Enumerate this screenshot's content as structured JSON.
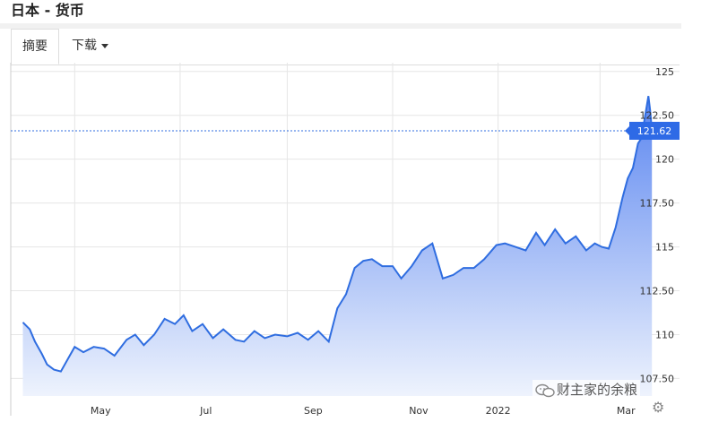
{
  "title": "日本 - 货币",
  "tabs": {
    "summary": "摘要",
    "download": "下载"
  },
  "watermark": "财主家的余粮",
  "icons": {
    "settings": "gear-icon",
    "watermark": "wechat-icon"
  },
  "colors": {
    "line": "#2f6de0",
    "fill_top": "#5b86f0",
    "fill_bottom": "#eef3fd",
    "current_label_bg": "#2e6ae6",
    "grid": "#e6e6e6"
  },
  "chart_data": {
    "type": "area",
    "title": "",
    "xlabel": "",
    "ylabel": "",
    "ylim": [
      106.5,
      125.5
    ],
    "yticks": [
      107.5,
      110,
      112.5,
      115,
      117.5,
      120,
      122.5,
      125
    ],
    "ytick_labels": [
      "107.50",
      "110",
      "112.50",
      "115",
      "117.50",
      "120",
      "122.50",
      "125"
    ],
    "xticks": [
      "May",
      "Jul",
      "Sep",
      "Nov",
      "2022",
      "Mar"
    ],
    "current_value": 121.62,
    "current_label": "121.62",
    "x": [
      "2021-04-01",
      "2021-04-05",
      "2021-04-08",
      "2021-04-12",
      "2021-04-15",
      "2021-04-19",
      "2021-04-23",
      "2021-04-27",
      "2021-05-01",
      "2021-05-06",
      "2021-05-12",
      "2021-05-18",
      "2021-05-24",
      "2021-05-31",
      "2021-06-05",
      "2021-06-10",
      "2021-06-16",
      "2021-06-22",
      "2021-06-28",
      "2021-07-03",
      "2021-07-08",
      "2021-07-14",
      "2021-07-20",
      "2021-07-26",
      "2021-08-02",
      "2021-08-07",
      "2021-08-13",
      "2021-08-19",
      "2021-08-25",
      "2021-09-01",
      "2021-09-07",
      "2021-09-13",
      "2021-09-19",
      "2021-09-25",
      "2021-09-30",
      "2021-10-05",
      "2021-10-10",
      "2021-10-15",
      "2021-10-20",
      "2021-10-26",
      "2021-11-01",
      "2021-11-06",
      "2021-11-12",
      "2021-11-18",
      "2021-11-24",
      "2021-11-30",
      "2021-12-06",
      "2021-12-12",
      "2021-12-18",
      "2021-12-24",
      "2021-12-31",
      "2022-01-05",
      "2022-01-11",
      "2022-01-17",
      "2022-01-23",
      "2022-01-28",
      "2022-02-03",
      "2022-02-09",
      "2022-02-15",
      "2022-02-21",
      "2022-02-26",
      "2022-03-02",
      "2022-03-06",
      "2022-03-10",
      "2022-03-14",
      "2022-03-17",
      "2022-03-20",
      "2022-03-23",
      "2022-03-25",
      "2022-03-27",
      "2022-03-29",
      "2022-03-30",
      "2022-03-31"
    ],
    "values": [
      110.7,
      110.3,
      109.6,
      108.9,
      108.3,
      108.0,
      107.9,
      108.6,
      109.3,
      109.0,
      109.3,
      109.2,
      108.8,
      109.7,
      110.0,
      109.4,
      110.0,
      110.9,
      110.6,
      111.1,
      110.2,
      110.6,
      109.8,
      110.3,
      109.7,
      109.6,
      110.2,
      109.8,
      110.0,
      109.9,
      110.1,
      109.7,
      110.2,
      109.6,
      111.5,
      112.3,
      113.8,
      114.2,
      114.3,
      113.9,
      113.9,
      113.2,
      113.9,
      114.8,
      115.2,
      113.2,
      113.4,
      113.8,
      113.8,
      114.3,
      115.1,
      115.2,
      115.0,
      114.8,
      115.8,
      115.1,
      116.0,
      115.2,
      115.6,
      114.8,
      115.2,
      115.0,
      114.9,
      116.1,
      117.8,
      118.9,
      119.5,
      120.9,
      121.2,
      122.4,
      123.6,
      122.8,
      121.62
    ]
  }
}
